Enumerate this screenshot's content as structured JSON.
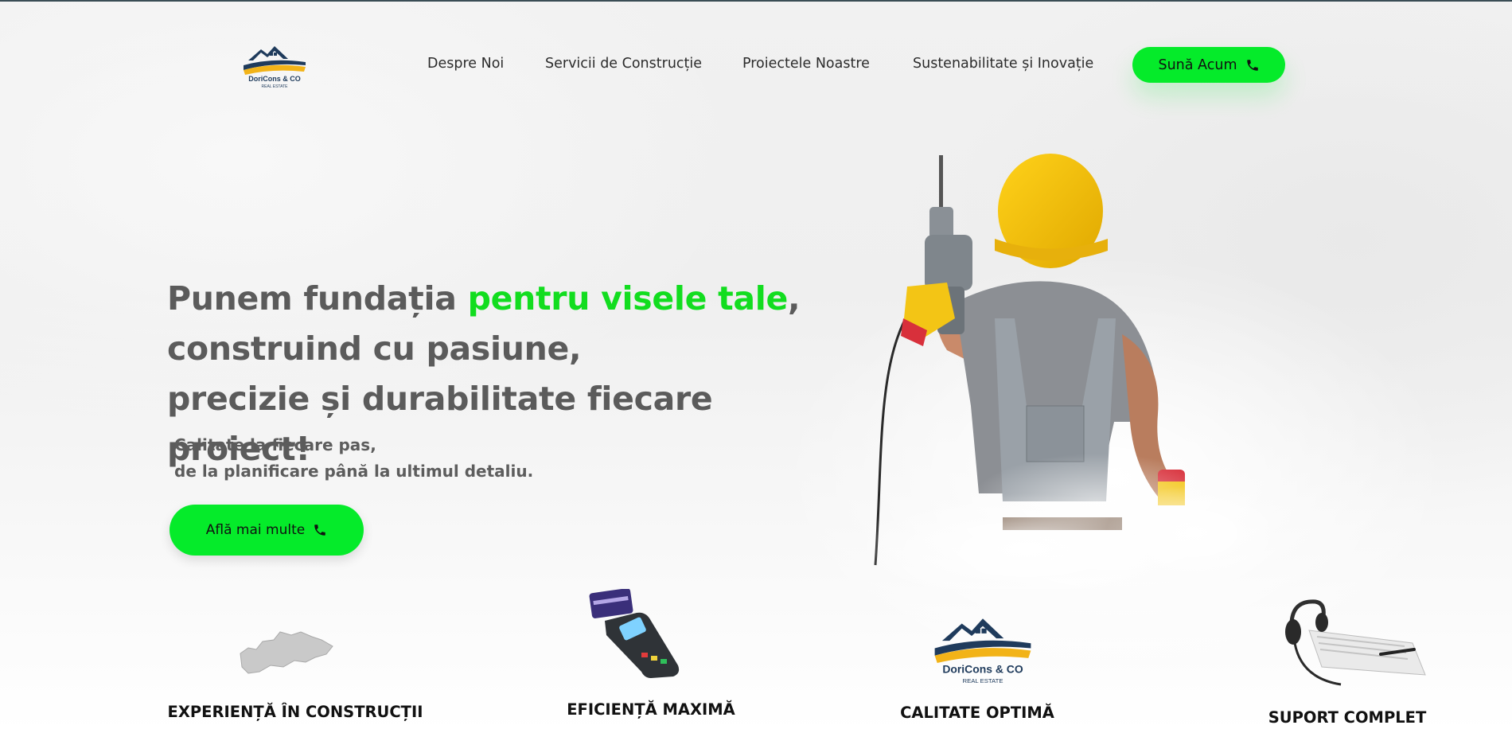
{
  "brand": {
    "logo_name": "DoriCons & CO",
    "logo_tagline": "REAL ESTATE"
  },
  "nav": {
    "items": [
      {
        "label": "Despre Noi"
      },
      {
        "label": "Servicii de Construcție"
      },
      {
        "label": "Proiectele Noastre"
      },
      {
        "label": "Sustenabilitate și Inovație"
      }
    ],
    "cta_label": "Sună Acum"
  },
  "hero": {
    "title_part1": "Punem fundația ",
    "title_accent": "pentru visele tale",
    "title_part2": ",",
    "title_line2": "construind cu pasiune,",
    "title_line3": "precizie și durabilitate fiecare proiect!",
    "subtitle_line1": "Calitate la fiecare pas,",
    "subtitle_line2": "de la planificare până la ultimul detaliu.",
    "button_label": "Află mai multe"
  },
  "features": [
    {
      "title": "EXPERIENȚĂ ÎN CONSTRUCȚII",
      "icon": "map-icon"
    },
    {
      "title": "EFICIENȚĂ MAXIMĂ",
      "icon": "card-terminal-icon"
    },
    {
      "title": "CALITATE OPTIMĂ",
      "icon": "company-logo-icon"
    },
    {
      "title": "SUPORT COMPLET",
      "icon": "headset-icon"
    }
  ],
  "colors": {
    "accent": "#05eb2a",
    "accent_text": "#12dd1f",
    "heading": "#5b5b5b",
    "logo_navy": "#1f3b5c",
    "logo_gold": "#f2b318"
  }
}
